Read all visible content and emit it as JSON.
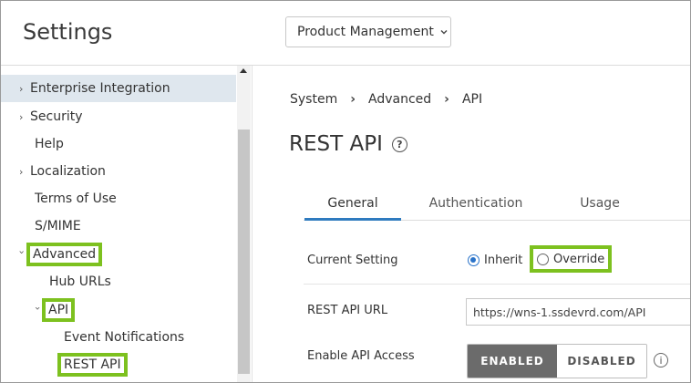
{
  "header": {
    "title": "Settings",
    "product_select": "Product Management"
  },
  "sidebar": {
    "items": [
      {
        "label": "Enterprise Integration",
        "caret": "›"
      },
      {
        "label": "Security",
        "caret": "›"
      },
      {
        "label": "Help",
        "caret": ""
      },
      {
        "label": "Localization",
        "caret": "›"
      },
      {
        "label": "Terms of Use",
        "caret": ""
      },
      {
        "label": "S/MIME",
        "caret": ""
      },
      {
        "label": "Advanced",
        "caret": "›"
      },
      {
        "label": "Hub URLs",
        "caret": ""
      },
      {
        "label": "API",
        "caret": "›"
      },
      {
        "label": "Event Notifications",
        "caret": ""
      },
      {
        "label": "REST API",
        "caret": ""
      }
    ]
  },
  "breadcrumb": {
    "items": [
      "System",
      "Advanced",
      "API"
    ],
    "separator": "›"
  },
  "page": {
    "title": "REST API",
    "help_glyph": "?"
  },
  "tabs": [
    {
      "label": "General",
      "active": true
    },
    {
      "label": "Authentication",
      "active": false
    },
    {
      "label": "Usage",
      "active": false
    }
  ],
  "form": {
    "current_setting": {
      "label": "Current Setting",
      "options": [
        "Inherit",
        "Override"
      ],
      "selected": "Inherit"
    },
    "rest_api_url": {
      "label": "REST API URL",
      "value": "https://wns-1.ssdevrd.com/API"
    },
    "enable_api_access": {
      "label": "Enable API Access",
      "on_label": "ENABLED",
      "off_label": "DISABLED",
      "value": "ENABLED",
      "info_glyph": "i"
    }
  },
  "colors": {
    "highlight": "#7dc11f",
    "accent": "#2f7bbf",
    "selected_nav_bg": "#dfe7ee",
    "toggle_on": "#6b6b6b"
  }
}
